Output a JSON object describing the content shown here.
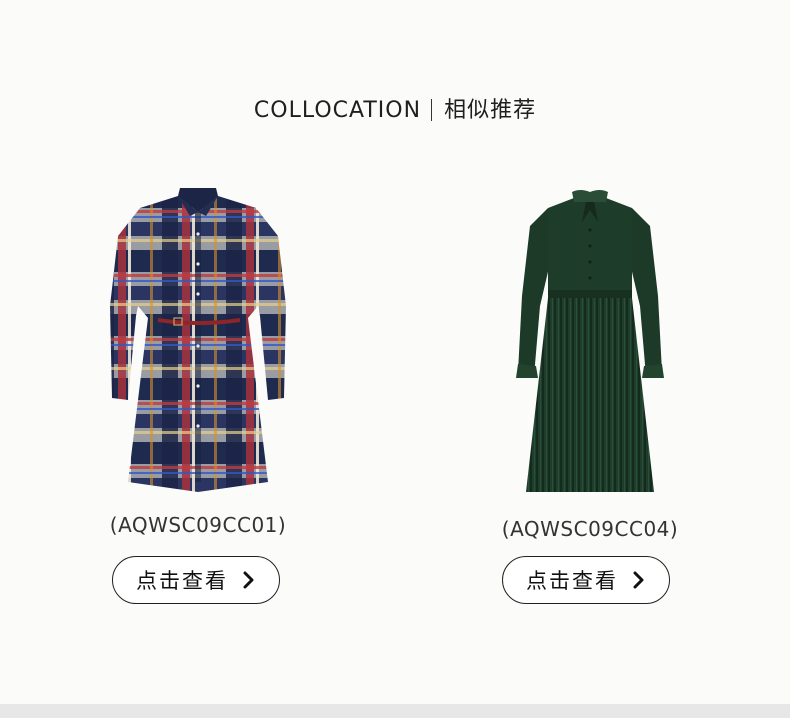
{
  "section": {
    "title_en": "COLLOCATION",
    "title_cn": "相似推荐"
  },
  "products": [
    {
      "code": "(AQWSC09CC01)",
      "button_label": "点击查看",
      "image": "plaid-shirt-dress-image"
    },
    {
      "code": "(AQWSC09CC04)",
      "button_label": "点击查看",
      "image": "green-pleated-dress-image"
    }
  ],
  "icons": {
    "button_arrow": "chevron-right-icon"
  },
  "colors": {
    "background": "#fbfbfa",
    "text": "#222222",
    "button_border": "#222222"
  }
}
